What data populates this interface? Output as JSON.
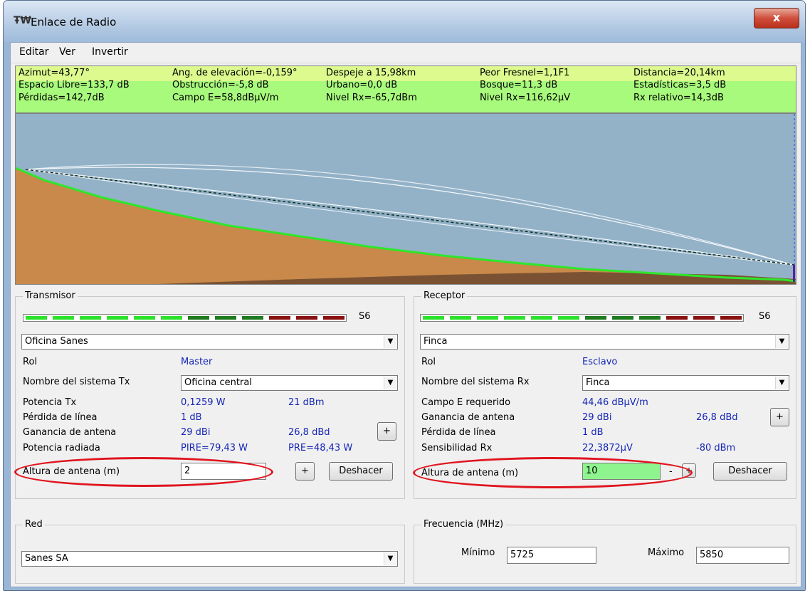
{
  "window": {
    "title": "Enlace de Radio",
    "icon_text": "Ŧ₩",
    "close_glyph": "x"
  },
  "menu": {
    "items": [
      "Editar",
      "Ver",
      "Invertir"
    ]
  },
  "info": {
    "rows": [
      [
        "Azimut=43,77°",
        "Ang. de elevación=-0,159°",
        "Despeje a 15,98km",
        "Peor Fresnel=1,1F1",
        "Distancia=20,14km"
      ],
      [
        "Espacio Libre=133,7 dB",
        "Obstrucción=-5,8 dB",
        "Urbano=0,0 dB",
        "Bosque=11,3 dB",
        "Estadísticas=3,5 dB"
      ],
      [
        "Pérdidas=142,7dB",
        "Campo E=58,8dBµV/m",
        "Nivel Rx=-65,7dBm",
        "Nivel Rx=116,62µV",
        "Rx relativo=14,3dB"
      ]
    ]
  },
  "colors": {
    "terrain": "#c8894a",
    "terrain_dark": "#7a5233",
    "sky": "#93b2c8",
    "green_line": "#2fe62b",
    "meter_green": "#2be22b",
    "meter_darkgreen": "#1e7a1e",
    "meter_red": "#8a1010",
    "highlight": "#8ef58e",
    "ellipse": "#e0141e"
  },
  "transmisor": {
    "title": "Transmisor",
    "signal": "S6",
    "station": "Oficina Sanes",
    "rol_label": "Rol",
    "rol_value": "Master",
    "sistema_label": "Nombre del sistema Tx",
    "sistema_value": "Oficina central",
    "potencia_label": "Potencia Tx",
    "potencia_w": "0,1259 W",
    "potencia_dbm": "21 dBm",
    "perdida_label": "Pérdida de línea",
    "perdida_value": "1 dB",
    "ganancia_label": "Ganancia de antena",
    "ganancia_dbi": "29 dBi",
    "ganancia_dbd": "26,8 dBd",
    "radiada_label": "Potencia radiada",
    "pire": "PIRE=79,43 W",
    "pre": "PRE=48,43 W",
    "altura_label": "Altura de antena (m)",
    "altura_value": "2",
    "plus_label": "+",
    "deshacer_label": "Deshacer"
  },
  "receptor": {
    "title": "Receptor",
    "signal": "S6",
    "station": "Finca",
    "rol_label": "Rol",
    "rol_value": "Esclavo",
    "sistema_label": "Nombre del sistema Rx",
    "sistema_value": "Finca",
    "campo_label": "Campo E requerido",
    "campo_value": "44,46 dBµV/m",
    "ganancia_label": "Ganancia de antena",
    "ganancia_dbi": "29 dBi",
    "ganancia_dbd": "26,8 dBd",
    "perdida_label": "Pérdida de línea",
    "perdida_value": "1 dB",
    "sens_label": "Sensibilidad Rx",
    "sens_uv": "22,3872µV",
    "sens_dbm": "-80 dBm",
    "altura_label": "Altura de antena (m)",
    "altura_value": "10",
    "minus_label": "-",
    "plus_label": "+",
    "deshacer_label": "Deshacer"
  },
  "red": {
    "title": "Red",
    "value": "Sanes SA"
  },
  "frecuencia": {
    "title": "Frecuencia (MHz)",
    "min_label": "Mínimo",
    "min_value": "5725",
    "max_label": "Máximo",
    "max_value": "5850"
  }
}
